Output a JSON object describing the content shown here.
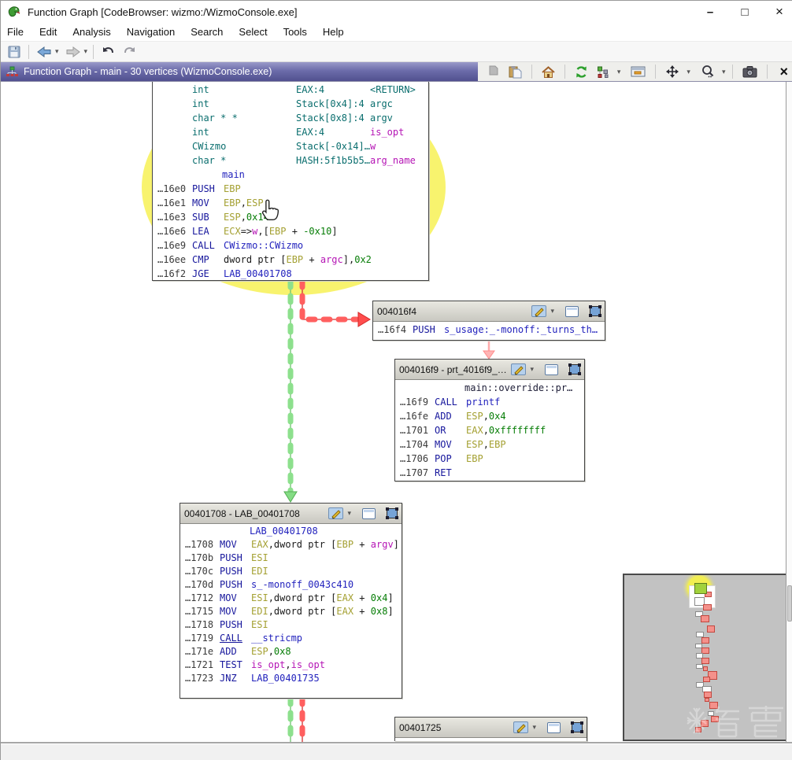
{
  "window": {
    "title": "Function Graph [CodeBrowser: wizmo:/WizmoConsole.exe]",
    "minimize_glyph": "–",
    "maximize_glyph": "□",
    "close_glyph": "×"
  },
  "menubar": [
    "File",
    "Edit",
    "Analysis",
    "Navigation",
    "Search",
    "Select",
    "Tools",
    "Help"
  ],
  "main_toolbar_icons": [
    "save-icon",
    "back-arrow-icon",
    "forward-arrow-icon",
    "undo-icon",
    "redo-icon"
  ],
  "fg_header": {
    "title": "Function Graph - main - 30 vertices  (WizmoConsole.exe)",
    "toolbar_icons": [
      "copy-icon",
      "paste-icon",
      "home-icon",
      "refresh-icon",
      "graph-layout-icon",
      "edge-display-icon",
      "pan-icon",
      "magnifier-icon",
      "snapshot-icon",
      "close-icon"
    ]
  },
  "glyphs": {
    "caret": "▾"
  },
  "block_header_icons": [
    "edit-label-pencil-icon",
    "chevron-down-icon",
    "maximize-block-icon",
    "group-selection-icon"
  ],
  "blocks": {
    "main": {
      "signature": [
        {
          "t": "int",
          "s": "EAX:4",
          "n": "<RETURN>",
          "nc": "t"
        },
        {
          "t": "int",
          "s": "Stack[0x4]:4",
          "n": "argc",
          "nc": "t"
        },
        {
          "t": "char * *",
          "s": "Stack[0x8]:4",
          "n": "argv",
          "nc": "t"
        },
        {
          "t": "int",
          "s": "EAX:4",
          "n": "is_opt",
          "nc": "v"
        },
        {
          "t": "CWizmo",
          "s": "Stack[-0x14]…",
          "n": "w",
          "nc": "v"
        },
        {
          "t": "char *",
          "s": "HASH:5f1b5b5…",
          "n": "arg_name",
          "nc": "v"
        }
      ],
      "rows": [
        {
          "lab": "main"
        },
        {
          "a": "…16e0",
          "m": "PUSH",
          "o": [
            [
              "r",
              "EBP"
            ]
          ]
        },
        {
          "a": "…16e1",
          "m": "MOV",
          "o": [
            [
              "r",
              "EBP"
            ],
            [
              "p",
              ","
            ],
            [
              "r",
              "ESP"
            ]
          ]
        },
        {
          "a": "…16e3",
          "m": "SUB",
          "o": [
            [
              "r",
              "ESP"
            ],
            [
              "p",
              ","
            ],
            [
              "n",
              "0x14"
            ]
          ]
        },
        {
          "a": "…16e6",
          "m": "LEA",
          "o": [
            [
              "r",
              "ECX"
            ],
            [
              "p",
              "=>"
            ],
            [
              "v",
              "w"
            ],
            [
              "p",
              ",["
            ],
            [
              "r",
              "EBP"
            ],
            [
              "p",
              " + "
            ],
            [
              "n",
              "-0x10"
            ],
            [
              "p",
              "]"
            ]
          ]
        },
        {
          "a": "…16e9",
          "m": "CALL",
          "o": [
            [
              "l",
              "CWizmo::CWizmo"
            ]
          ]
        },
        {
          "a": "…16ee",
          "m": "CMP",
          "o": [
            [
              "p",
              "dword ptr ["
            ],
            [
              "r",
              "EBP"
            ],
            [
              "p",
              " + "
            ],
            [
              "v",
              "argc"
            ],
            [
              "p",
              "],"
            ],
            [
              "n",
              "0x2"
            ]
          ]
        },
        {
          "a": "…16f2",
          "m": "JGE",
          "o": [
            [
              "l",
              "LAB_00401708"
            ]
          ]
        }
      ]
    },
    "b16f4": {
      "header": "004016f4",
      "rows": [
        {
          "a": "…16f4",
          "m": "PUSH",
          "o": [
            [
              "l",
              "s_usage:_-monoff:_turns_th…"
            ]
          ]
        }
      ]
    },
    "b16f9": {
      "header": "004016f9 - prt_4016f9_4…",
      "rows": [
        {
          "lab": "main::override::pr…",
          "dk": true
        },
        {
          "a": "…16f9",
          "m": "CALL",
          "o": [
            [
              "l",
              "printf"
            ]
          ]
        },
        {
          "a": "…16fe",
          "m": "ADD",
          "o": [
            [
              "r",
              "ESP"
            ],
            [
              "p",
              ","
            ],
            [
              "n",
              "0x4"
            ]
          ]
        },
        {
          "a": "…1701",
          "m": "OR",
          "o": [
            [
              "r",
              "EAX"
            ],
            [
              "p",
              ","
            ],
            [
              "n",
              "0xffffffff"
            ]
          ]
        },
        {
          "a": "…1704",
          "m": "MOV",
          "o": [
            [
              "r",
              "ESP"
            ],
            [
              "p",
              ","
            ],
            [
              "r",
              "EBP"
            ]
          ]
        },
        {
          "a": "…1706",
          "m": "POP",
          "o": [
            [
              "r",
              "EBP"
            ]
          ]
        },
        {
          "a": "…1707",
          "m": "RET",
          "o": []
        }
      ]
    },
    "b1708": {
      "header": "00401708 - LAB_00401708",
      "rows": [
        {
          "lab": "LAB_00401708"
        },
        {
          "a": "…1708",
          "m": "MOV",
          "o": [
            [
              "r",
              "EAX"
            ],
            [
              "p",
              ",dword ptr ["
            ],
            [
              "r",
              "EBP"
            ],
            [
              "p",
              " + "
            ],
            [
              "v",
              "argv"
            ],
            [
              "p",
              "]"
            ]
          ]
        },
        {
          "a": "…170b",
          "m": "PUSH",
          "o": [
            [
              "r",
              "ESI"
            ]
          ]
        },
        {
          "a": "…170c",
          "m": "PUSH",
          "o": [
            [
              "r",
              "EDI"
            ]
          ]
        },
        {
          "a": "…170d",
          "m": "PUSH",
          "o": [
            [
              "l",
              "s_-monoff_0043c410"
            ]
          ]
        },
        {
          "a": "…1712",
          "m": "MOV",
          "o": [
            [
              "r",
              "ESI"
            ],
            [
              "p",
              ",dword ptr ["
            ],
            [
              "r",
              "EAX"
            ],
            [
              "p",
              " + "
            ],
            [
              "n",
              "0x4"
            ],
            [
              "p",
              "]"
            ]
          ]
        },
        {
          "a": "…1715",
          "m": "MOV",
          "o": [
            [
              "r",
              "EDI"
            ],
            [
              "p",
              ",dword ptr ["
            ],
            [
              "r",
              "EAX"
            ],
            [
              "p",
              " + "
            ],
            [
              "n",
              "0x8"
            ],
            [
              "p",
              "]"
            ]
          ]
        },
        {
          "a": "…1718",
          "m": "PUSH",
          "o": [
            [
              "r",
              "ESI"
            ]
          ]
        },
        {
          "a": "…1719",
          "m": "CALL",
          "u": true,
          "o": [
            [
              "l",
              "__stricmp"
            ]
          ]
        },
        {
          "a": "…171e",
          "m": "ADD",
          "o": [
            [
              "r",
              "ESP"
            ],
            [
              "p",
              ","
            ],
            [
              "n",
              "0x8"
            ]
          ]
        },
        {
          "a": "…1721",
          "m": "TEST",
          "o": [
            [
              "v",
              "is_opt"
            ],
            [
              "p",
              ","
            ],
            [
              "v",
              "is_opt"
            ]
          ]
        },
        {
          "a": "…1723",
          "m": "JNZ",
          "o": [
            [
              "l",
              "LAB_00401735"
            ]
          ]
        }
      ]
    },
    "b1725": {
      "header": "00401725",
      "rows": []
    }
  },
  "satellite": {
    "blocks": [
      [
        102,
        21,
        9,
        7,
        "r"
      ],
      [
        89,
        28,
        13,
        11,
        "w"
      ],
      [
        100,
        37,
        11,
        8,
        "r"
      ],
      [
        90,
        46,
        10,
        7,
        "w"
      ],
      [
        97,
        51,
        11,
        9,
        "r"
      ],
      [
        105,
        64,
        10,
        9,
        "r"
      ],
      [
        91,
        72,
        10,
        7,
        "w"
      ],
      [
        98,
        79,
        10,
        8,
        "r"
      ],
      [
        90,
        87,
        9,
        6,
        "w"
      ],
      [
        98,
        92,
        10,
        8,
        "r"
      ],
      [
        91,
        99,
        9,
        7,
        "w"
      ],
      [
        98,
        105,
        10,
        8,
        "r"
      ],
      [
        91,
        113,
        9,
        6,
        "w"
      ],
      [
        100,
        116,
        6,
        6,
        "r"
      ],
      [
        106,
        122,
        12,
        11,
        "r"
      ],
      [
        100,
        129,
        9,
        7,
        "r"
      ],
      [
        91,
        136,
        10,
        7,
        "w"
      ],
      [
        99,
        141,
        12,
        8,
        "w"
      ],
      [
        101,
        148,
        10,
        8,
        "r"
      ],
      [
        102,
        156,
        6,
        5,
        "r"
      ],
      [
        108,
        161,
        11,
        9,
        "r"
      ],
      [
        106,
        173,
        8,
        6,
        "w"
      ],
      [
        110,
        179,
        10,
        8,
        "r"
      ],
      [
        97,
        184,
        10,
        9,
        "r"
      ],
      [
        90,
        193,
        8,
        7,
        "r"
      ],
      [
        89,
        10,
        16,
        14,
        "g"
      ]
    ]
  },
  "colors": {
    "jump_edge_green": "#8de08d",
    "fallthrough_edge_red": "#ff5f5f",
    "hover_highlight_yellow": "#f8f36e",
    "mnemonic_blue": "#16169c",
    "register_olive": "#a4a032",
    "constant_green": "#067d06",
    "variable_magenta": "#b515b5",
    "type_teal": "#0a6e6e",
    "satellite_block_red": "#f4918b"
  }
}
